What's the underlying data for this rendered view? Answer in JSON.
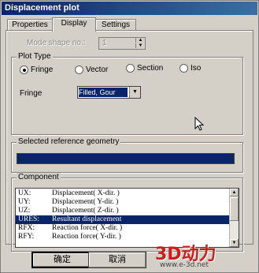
{
  "window": {
    "title": "Displacement plot"
  },
  "tabs": [
    {
      "label": "Properties",
      "active": false
    },
    {
      "label": "Display",
      "active": true
    },
    {
      "label": "Settings",
      "active": false
    }
  ],
  "mode_shape": {
    "label": "Mode shape no.:",
    "value": "1"
  },
  "plot_type": {
    "title": "Plot Type",
    "options": [
      "Fringe",
      "Vector",
      "Section",
      "Iso"
    ],
    "selected": "Fringe"
  },
  "fringe": {
    "label": "Fringe",
    "value": "Filled, Gour"
  },
  "selected_reference": {
    "title": "Selected reference geometry"
  },
  "component": {
    "title": "Component",
    "items": [
      {
        "code": "UX:",
        "desc": "Displacement( X-dir. )"
      },
      {
        "code": "UY:",
        "desc": "Displacement( Y-dir. )"
      },
      {
        "code": "UZ:",
        "desc": "Displacement( Z-dir. )"
      },
      {
        "code": "URES:",
        "desc": "Resultant displacement"
      },
      {
        "code": "RFX:",
        "desc": "Reaction force( X-dir. )"
      },
      {
        "code": "RFY:",
        "desc": "Reaction force( Y-dir. )"
      }
    ],
    "selected_index": 3
  },
  "buttons": {
    "ok": "确定",
    "cancel": "取消"
  },
  "watermark": {
    "brand": "3D动力",
    "url": "www.e-3d.net"
  },
  "colors": {
    "title_bar": "#0a246a",
    "selection": "#0a246a",
    "face": "#d4d0c8"
  }
}
